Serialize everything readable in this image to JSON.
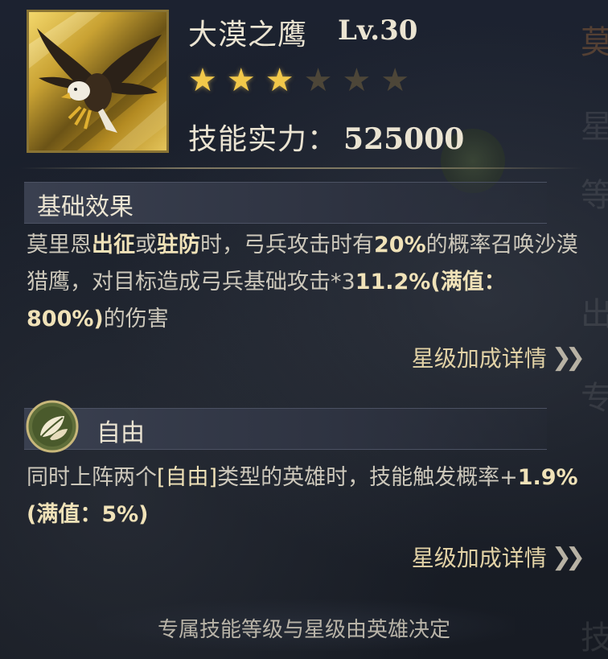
{
  "skill": {
    "name": "大漠之鹰",
    "level": "Lv.30",
    "stars_filled": 3,
    "stars_total": 6,
    "power_label": "技能实力：",
    "power_value": "525000"
  },
  "basic_effect": {
    "title": "基础效果",
    "desc_parts": [
      "莫里恩",
      "出征",
      "或",
      "驻防",
      "时，弓兵攻击时有",
      "20%",
      "的概率召唤沙漠猎鹰，对目标造成弓兵基础攻击*3",
      "11.2%(满值：800%)",
      "的伤害"
    ],
    "detail_link": "星级加成详情"
  },
  "trait_effect": {
    "title": "自由",
    "icon": "leaf-icon",
    "desc_parts": [
      "同时上阵两个",
      "[自由]",
      "类型的英雄时，技能触发概率+",
      "1.9%(满值：5%)"
    ],
    "detail_link": "星级加成详情"
  },
  "footer_note": "专属技能等级与星级由英雄决定",
  "background_glyphs": [
    "莫",
    "星",
    "等",
    "出",
    "专",
    "技"
  ],
  "colors": {
    "star_on": "#f2c84a",
    "star_off": "#4d4638",
    "highlight": "#f0e2b8",
    "text": "#cdc8bb"
  }
}
